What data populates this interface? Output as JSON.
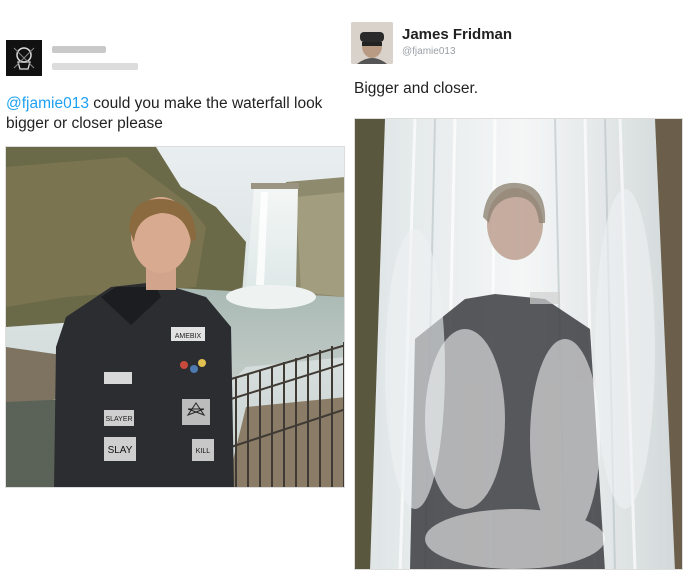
{
  "left_tweet": {
    "mention": "@fjamie013",
    "text": " could you make the waterfall look bigger or closer please"
  },
  "right_tweet": {
    "name": "James Fridman",
    "handle": "@fjamie013",
    "text": "Bigger and closer."
  },
  "patches": {
    "patch1": "AMEBIX",
    "patch2": "SLAYER",
    "patch3": "SLAY",
    "patch4": "KILL",
    "patch5": "ANTHRAX"
  },
  "colors": {
    "mention": "#1da1f2",
    "text": "#222222",
    "handle": "#9aa0a6"
  }
}
